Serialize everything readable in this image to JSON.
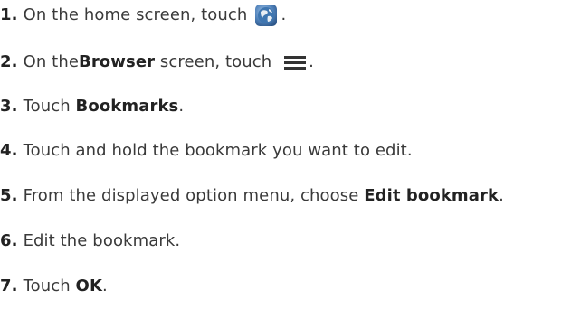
{
  "steps": [
    {
      "num": "1.",
      "parts": [
        {
          "t": "On the home screen, touch "
        }
      ],
      "icon": "globe-icon",
      "after": "."
    },
    {
      "num": "2.",
      "parts": [
        {
          "t": "On the "
        },
        {
          "b": "Browser"
        },
        {
          "t": " screen, touch "
        }
      ],
      "icon": "menu-icon",
      "after": "."
    },
    {
      "num": "3.",
      "parts": [
        {
          "t": "Touch "
        },
        {
          "b": "Bookmarks"
        },
        {
          "t": "."
        }
      ]
    },
    {
      "num": "4.",
      "parts": [
        {
          "t": "Touch and hold the bookmark you want to edit."
        }
      ]
    },
    {
      "num": "5.",
      "parts": [
        {
          "t": "From the displayed option menu, choose "
        },
        {
          "b": "Edit bookmark"
        },
        {
          "t": "."
        }
      ]
    },
    {
      "num": "6.",
      "parts": [
        {
          "t": "Edit the bookmark."
        }
      ]
    },
    {
      "num": "7.",
      "parts": [
        {
          "t": "Touch "
        },
        {
          "b": "OK"
        },
        {
          "t": "."
        }
      ]
    }
  ]
}
